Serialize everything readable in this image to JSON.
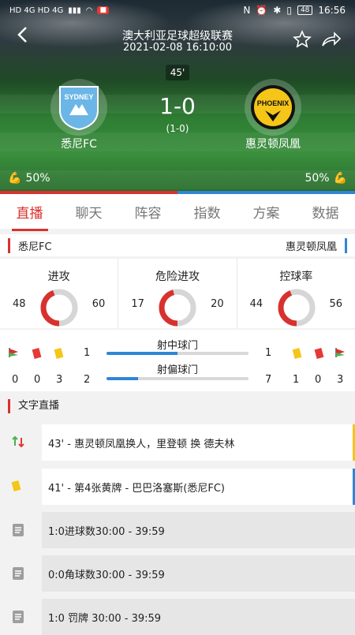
{
  "status_bar": {
    "left": "HD 4G HD 4G",
    "time": "16:56",
    "battery": "48"
  },
  "header": {
    "league": "澳大利亚足球超级联赛",
    "datetime": "2021-02-08 16:10:00",
    "minute": "45'"
  },
  "match": {
    "home_team": "悉尼FC",
    "away_team": "惠灵顿凤凰",
    "score": "1-0",
    "half_time": "(1-0)",
    "home_possession": "50%",
    "away_possession": "50%"
  },
  "logos": {
    "home_text": "SYDNEY FC",
    "away_text": "PHOENIX"
  },
  "tabs": [
    "直播",
    "聊天",
    "阵容",
    "指数",
    "方案",
    "数据"
  ],
  "active_tab": 0,
  "team_row": {
    "home": "悉尼FC",
    "away": "惠灵顿凤凰"
  },
  "stats": [
    {
      "label": "进攻",
      "home": "48",
      "away": "60",
      "home_val": 48,
      "away_val": 60
    },
    {
      "label": "危险进攻",
      "home": "17",
      "away": "20",
      "home_val": 17,
      "away_val": 20
    },
    {
      "label": "控球率",
      "home": "44",
      "away": "56",
      "home_val": 44,
      "away_val": 56
    }
  ],
  "shots": {
    "on_target": {
      "label": "射中球门",
      "home": "1",
      "away": "1",
      "fraction": 0.5
    },
    "off_target": {
      "label": "射偏球门",
      "home": "2",
      "away": "7",
      "fraction": 0.22
    },
    "home_counts": [
      "0",
      "0",
      "3"
    ],
    "away_counts": [
      "1",
      "0",
      "3"
    ]
  },
  "live_section": {
    "title": "文字直播"
  },
  "events": [
    {
      "text": "43' - 惠灵顿凤凰换人，里登顿 换 德夫林",
      "icon": "substitution-icon",
      "edge": "#f5c518"
    },
    {
      "text": "41' - 第4张黄牌 - 巴巴洛塞斯(悉尼FC)",
      "icon": "yellow-card-icon",
      "edge": "#2f86d6"
    },
    {
      "text": "1:0进球数30:00 - 39:59",
      "icon": "document-icon",
      "edge": ""
    },
    {
      "text": "0:0角球数30:00 - 39:59",
      "icon": "document-icon",
      "edge": ""
    },
    {
      "text": "1:0 罚牌 30:00 - 39:59",
      "icon": "document-icon",
      "edge": ""
    }
  ],
  "colors": {
    "home": "#d8322e",
    "away": "#2f86d6",
    "yellow": "#f5c518"
  }
}
